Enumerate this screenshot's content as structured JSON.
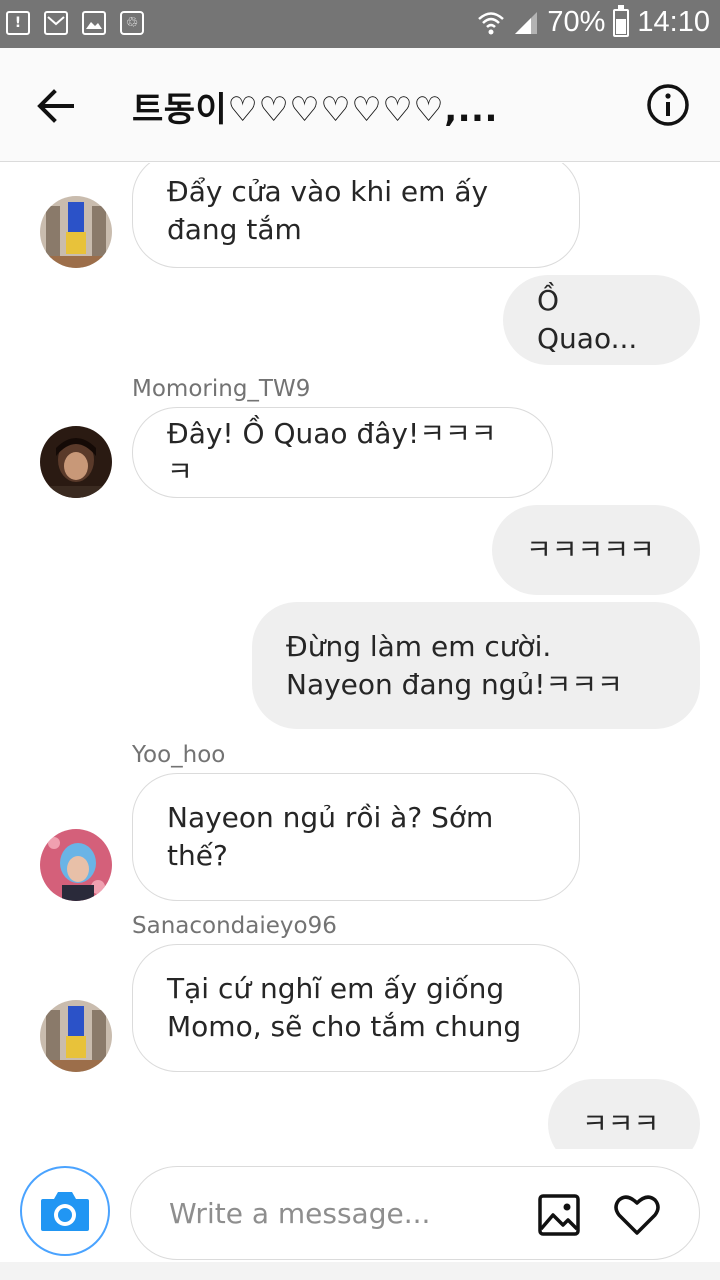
{
  "status_bar": {
    "battery": "70%",
    "time": "14:10",
    "left_icons": [
      "notification-icon",
      "mail-icon",
      "image-icon",
      "recycle-icon"
    ],
    "right_icons": [
      "wifi-icon",
      "signal-icon",
      "battery-icon"
    ]
  },
  "header": {
    "title": "트동이♡♡♡♡♡♡♡,...",
    "back_icon": "arrow-left-icon",
    "info_icon": "info-icon"
  },
  "messages": [
    {
      "direction": "in",
      "sender": "",
      "text_lines": [
        "Đẩy cửa vào khi em ấy",
        "đang tắm"
      ],
      "avatar_color": "#b8a89a"
    },
    {
      "direction": "out",
      "text_lines": [
        "Ồ Quao..."
      ]
    },
    {
      "direction": "in",
      "sender": "Momoring_TW9",
      "text_lines": [
        "Đây! Ồ Quao đây!ㅋㅋㅋㅋ"
      ],
      "avatar_color": "#3a2418"
    },
    {
      "direction": "out",
      "text_lines": [
        "ㅋㅋㅋㅋㅋ"
      ]
    },
    {
      "direction": "out",
      "text_lines": [
        "Đừng làm em cười.",
        "Nayeon đang ngủ!ㅋㅋㅋ"
      ]
    },
    {
      "direction": "in",
      "sender": "Yoo_hoo",
      "text_lines": [
        "Nayeon ngủ rồi à? Sớm",
        "thế?"
      ],
      "avatar_color": "#c4506a"
    },
    {
      "direction": "in",
      "sender": "Sanacondaieyo96",
      "text_lines": [
        "Tại cứ nghĩ em ấy giống",
        "Momo, sẽ cho tắm chung"
      ],
      "avatar_color": "#b8a89a"
    },
    {
      "direction": "out",
      "text_lines": [
        "ㅋㅋㅋ"
      ]
    }
  ],
  "composer": {
    "placeholder": "Write a message...",
    "camera_icon": "camera-icon",
    "gallery_icon": "gallery-icon",
    "heart_icon": "heart-icon"
  },
  "colors": {
    "status_bar": "#757575",
    "header_bg": "#fafafa",
    "incoming_border": "#dbdbdb",
    "outgoing_bg": "#efefef",
    "camera_ring": "#4aa3ff",
    "camera_fill": "#2196f3"
  }
}
